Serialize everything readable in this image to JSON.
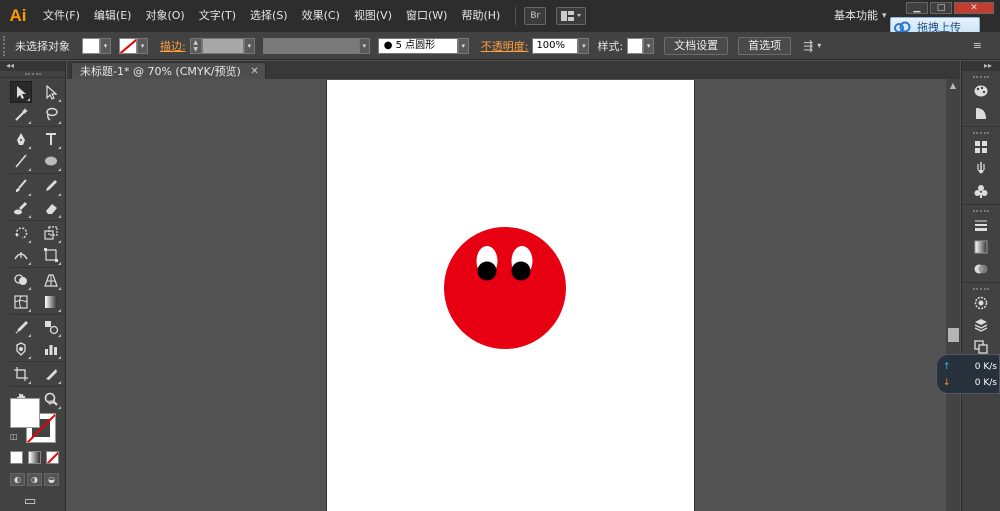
{
  "app": {
    "logo_text": "Ai",
    "menu": [
      "文件(F)",
      "编辑(E)",
      "对象(O)",
      "文字(T)",
      "选择(S)",
      "效果(C)",
      "视图(V)",
      "窗口(W)",
      "帮助(H)"
    ],
    "bridge_button": "Br",
    "workspace_label": "基本功能",
    "workspace_arrow": "▾",
    "upload_button_label": "拖拽上传",
    "window_controls": {
      "minimize": "▁",
      "maximize": "□",
      "close": "✕"
    }
  },
  "control_bar": {
    "selection_status": "未选择对象",
    "stroke_label": "描边:",
    "brush_value": "● 5 点圆形",
    "opacity_label": "不透明度:",
    "opacity_value": "100%",
    "style_label": "样式:",
    "doc_setup_button": "文档设置",
    "preferences_button": "首选项",
    "dropdown_arrow": "▾"
  },
  "document": {
    "tab_title": "未标题-1* @ 70% (CMYK/预览)",
    "tab_close": "✕",
    "artwork": {
      "shape": "circle-face",
      "face_color": "#e60012",
      "eye_white_color": "#ffffff",
      "pupil_color": "#000000"
    }
  },
  "tools": [
    {
      "name": "selection-tool",
      "icon": "arrow",
      "active": true
    },
    {
      "name": "direct-selection-tool",
      "icon": "hollow-arrow"
    },
    {
      "name": "magic-wand-tool",
      "icon": "wand"
    },
    {
      "name": "lasso-tool",
      "icon": "lasso"
    },
    {
      "name": "pen-tool",
      "icon": "pen"
    },
    {
      "name": "type-tool",
      "icon": "T"
    },
    {
      "name": "line-segment-tool",
      "icon": "line"
    },
    {
      "name": "ellipse-tool",
      "icon": "ellipse"
    },
    {
      "name": "paintbrush-tool",
      "icon": "brush"
    },
    {
      "name": "pencil-tool",
      "icon": "pencil"
    },
    {
      "name": "blob-brush-tool",
      "icon": "blob"
    },
    {
      "name": "eraser-tool",
      "icon": "eraser"
    },
    {
      "name": "rotate-tool",
      "icon": "rotate"
    },
    {
      "name": "scale-tool",
      "icon": "scale"
    },
    {
      "name": "width-tool",
      "icon": "width"
    },
    {
      "name": "free-transform-tool",
      "icon": "free-transform"
    },
    {
      "name": "shape-builder-tool",
      "icon": "shape-builder"
    },
    {
      "name": "perspective-grid-tool",
      "icon": "perspective"
    },
    {
      "name": "mesh-tool",
      "icon": "mesh"
    },
    {
      "name": "gradient-tool",
      "icon": "gradient"
    },
    {
      "name": "eyedropper-tool",
      "icon": "eyedropper"
    },
    {
      "name": "blend-tool",
      "icon": "blend"
    },
    {
      "name": "symbol-sprayer-tool",
      "icon": "symbol"
    },
    {
      "name": "column-graph-tool",
      "icon": "graph"
    },
    {
      "name": "artboard-tool",
      "icon": "artboard"
    },
    {
      "name": "slice-tool",
      "icon": "slice"
    },
    {
      "name": "hand-tool",
      "icon": "hand"
    },
    {
      "name": "zoom-tool",
      "icon": "zoom"
    }
  ],
  "colors": {
    "fill": "#ffffff",
    "stroke": "none"
  },
  "dock_panels": [
    [
      "color-panel",
      "color-guide-panel"
    ],
    [
      "swatches-panel",
      "brushes-panel",
      "symbols-panel"
    ],
    [
      "stroke-panel",
      "gradient-panel",
      "transparency-panel"
    ],
    [
      "appearance-panel",
      "layers-panel",
      "artboards-panel"
    ]
  ],
  "net_speed": {
    "up": "0 K/s",
    "down": "0 K/s",
    "up_arrow": "↑",
    "down_arrow": "↓"
  }
}
